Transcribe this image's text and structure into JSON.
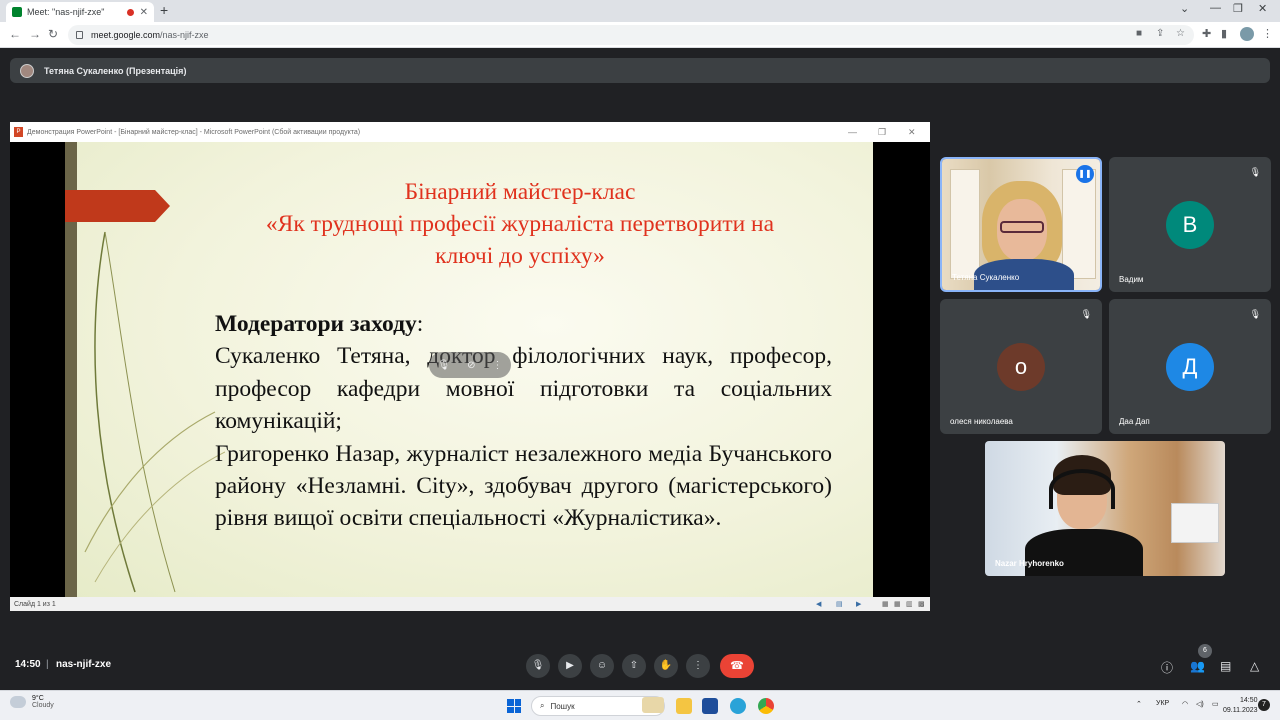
{
  "browser": {
    "tab_title": "Meet: \"nas-njif-zxe\"",
    "url_host": "meet.google.com",
    "url_path": "/nas-njif-zxe"
  },
  "meet": {
    "presenter_label": "Тетяна Сукаленко (Презентація)",
    "time": "14:50",
    "separator": "|",
    "meeting_code": "nas-njif-zxe",
    "participant_count": "6"
  },
  "ppt": {
    "window_title": "Демонстрация PowerPoint - [Бінарний майстер-клас] - Microsoft PowerPoint (Сбой активации продукта)",
    "status_text": "Слайд 1 из 1"
  },
  "slide": {
    "title_line1": "Бінарний майстер-клас",
    "title_line2": "«Як труднощі професії журналіста перетворити на",
    "title_line3": "ключі до успіху»",
    "moderators_heading": "Модератори заходу",
    "moderators_colon": ":",
    "para1": "Сукаленко Тетяна, доктор філологічних наук, професор, професор кафедри мовної підготовки та соціальних комунікацій;",
    "para2": "Григоренко Назар, журналіст незалежного медіа Бучанського району «Незламні. City», здобувач другого (магістерського) рівня вищої освіти спеціальності «Журналістика»."
  },
  "participants": [
    {
      "name": "Тетяна Сукаленко"
    },
    {
      "name": "Вадим",
      "initial": "В",
      "color": "#00897b"
    },
    {
      "name": "олеся николаева",
      "initial": "о",
      "color": "#6d3a2a"
    },
    {
      "name": "Даа Дап",
      "initial": "Д",
      "color": "#1e88e5"
    },
    {
      "name": "Nazar Hryhorenko"
    }
  ],
  "taskbar": {
    "temperature": "9°C",
    "weather": "Cloudy",
    "search_label": "Пошук",
    "language": "УКР",
    "clock_time": "14:50",
    "clock_date": "09.11.2023",
    "notification_count": "7"
  },
  "colors": {
    "meet_bg": "#202124",
    "hangup": "#ea4335",
    "slide_title": "#e0321e",
    "active_speaker": "#1a73e8"
  }
}
